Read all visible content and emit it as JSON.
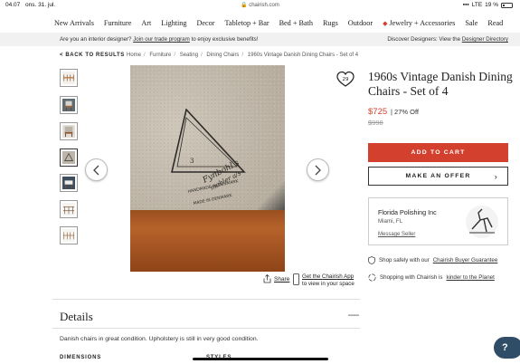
{
  "status_bar": {
    "time": "04.07",
    "date": "ons. 31. jul.",
    "url": "chairish.com",
    "network": "LTE",
    "battery": "19 %"
  },
  "nav": {
    "items": [
      "New Arrivals",
      "Furniture",
      "Art",
      "Lighting",
      "Decor",
      "Tabletop + Bar",
      "Bed + Bath",
      "Rugs",
      "Outdoor",
      "Jewelry + Accessories",
      "Sale",
      "Read"
    ]
  },
  "promo": {
    "left_text": "Are you an interior designer?",
    "left_link": "Join our trade program",
    "left_suffix": "to enjoy exclusive benefits!",
    "right_text": "Discover Designers: View the",
    "right_link": "Designer Directory"
  },
  "breadcrumb": {
    "back": "< BACK TO RESULTS",
    "items": [
      "Home",
      "Furniture",
      "Seating",
      "Dining Chairs",
      "1960s Vintage Danish Dining Chairs - Set of 4"
    ]
  },
  "product": {
    "favorites_count": "29",
    "title": "1960s Vintage Danish Dining Chairs - Set of 4",
    "price": "$725",
    "discount": "| 27% Off",
    "original_price": "$998",
    "add_to_cart": "ADD TO CART",
    "make_offer": "MAKE AN OFFER",
    "stamp_text": {
      "number": "3",
      "maker": "Fynbohl's",
      "maker_line2": "møbler a/s",
      "ring": "HANDMADE IN DENMARK",
      "origin": "MADE IN DENMARK"
    }
  },
  "share": {
    "label": "Share",
    "app_text": "Get the Chairish App",
    "app_text2": "to view in your space"
  },
  "seller": {
    "name": "Florida Polishing Inc",
    "location": "Miami, FL",
    "message": "Message Seller"
  },
  "assurances": {
    "buyer": "Shop safely with our",
    "buyer_link": "Chairish Buyer Guarantee",
    "planet": "Shopping with Chairish is",
    "planet_link": "kinder to the Planet"
  },
  "details": {
    "title": "Details",
    "description": "Danish chairs in great condition. Upholstery is still in very good condition.",
    "dimensions_label": "DIMENSIONS",
    "styles_label": "STYLES"
  },
  "help": {
    "label": "?"
  },
  "colors": {
    "accent": "#d3402e",
    "help_bg": "#2f4d66"
  }
}
